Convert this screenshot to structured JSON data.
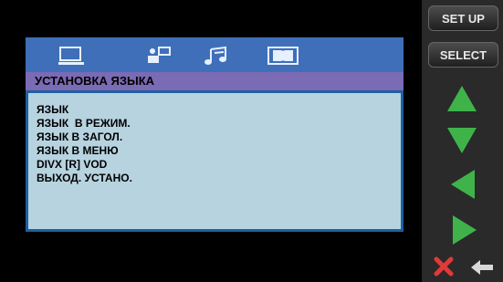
{
  "tabs": [
    {
      "icon": "monitor-icon"
    },
    {
      "icon": "speaker-icon"
    },
    {
      "icon": "music-note-icon"
    },
    {
      "icon": "dolby-icon"
    }
  ],
  "header": {
    "title": "УСТАНОВКА ЯЗЫКА"
  },
  "menu": {
    "items": [
      "ЯЗЫК",
      "ЯЗЫК  В РЕЖИМ.",
      "ЯЗЫК В ЗАГОЛ.",
      "ЯЗЫК В МЕНЮ",
      "DIVX [R] VOD",
      "ВЫХОД. УСТАНО."
    ]
  },
  "sidebar": {
    "setup_label": "SET UP",
    "select_label": "SELECT",
    "arrow_icons": [
      "arrow-up-icon",
      "arrow-down-icon",
      "arrow-left-icon",
      "arrow-right-icon"
    ],
    "bottom_icons": [
      "close-icon",
      "back-icon"
    ]
  },
  "colors": {
    "tab_bar": "#3f6fb9",
    "header": "#7b6ab4",
    "menu_bg": "#b7d3e0",
    "arrow_green": "#3fb34a",
    "close_red": "#e03a3a"
  }
}
